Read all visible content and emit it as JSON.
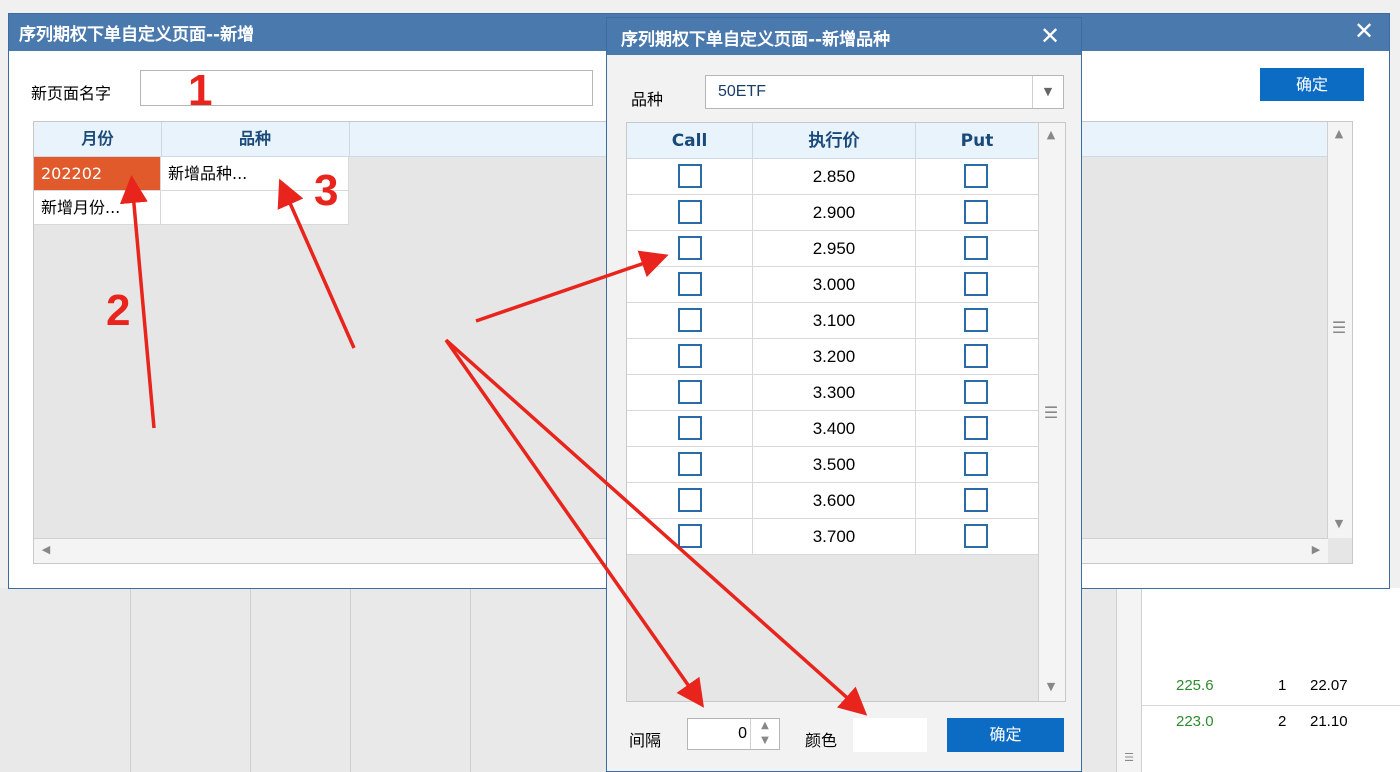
{
  "main_dialog": {
    "title": "序列期权下单自定义页面--新增",
    "close_glyph": "✕",
    "page_name_label": "新页面名字",
    "page_name_value": "",
    "confirm_label": "确定",
    "grid": {
      "columns": [
        "月份",
        "品种"
      ],
      "rows": [
        {
          "month": "202202",
          "variety": "新增品种...",
          "selected": true
        },
        {
          "month": "新增月份...",
          "variety": ""
        }
      ]
    }
  },
  "variety_dialog": {
    "title": "序列期权下单自定义页面--新增品种",
    "close_glyph": "✕",
    "variety_label": "品种",
    "variety_value": "50ETF",
    "table": {
      "columns": [
        "Call",
        "执行价",
        "Put"
      ],
      "strikes": [
        "2.850",
        "2.900",
        "2.950",
        "3.000",
        "3.100",
        "3.200",
        "3.300",
        "3.400",
        "3.500",
        "3.600",
        "3.700"
      ]
    },
    "interval_label": "间隔",
    "interval_value": "0",
    "color_label": "颜色",
    "confirm_label": "确定"
  },
  "background_app": {
    "rows": [
      {
        "price": "225.6",
        "qty": "1",
        "value": "22.07"
      },
      {
        "price": "223.0",
        "qty": "2",
        "value": "21.10"
      }
    ]
  },
  "annotations": {
    "labels": [
      "1",
      "2",
      "3"
    ],
    "color": "#e8241c"
  },
  "colors": {
    "titlebar": "#4a79ad",
    "button": "#0c6cc4",
    "selected_cell": "#e05a2b",
    "header_bg": "#e8f3fb",
    "price_green": "#2e8b2e"
  }
}
